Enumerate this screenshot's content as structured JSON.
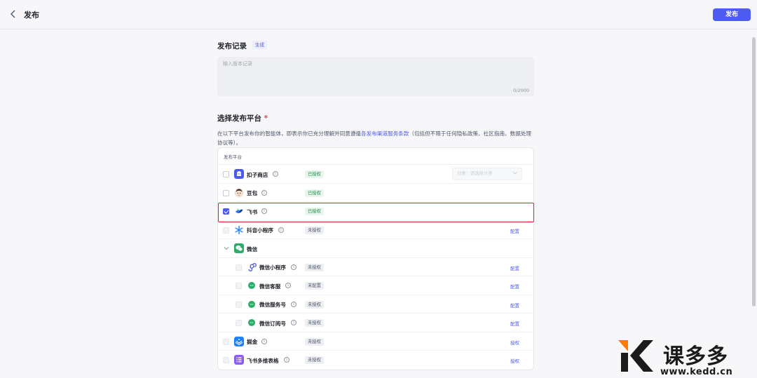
{
  "header": {
    "title": "发布",
    "publish_label": "发布"
  },
  "record": {
    "title": "发布记录",
    "generate_label": "生成",
    "placeholder": "输入版本记录",
    "counter": "0/2000"
  },
  "platforms": {
    "title": "选择发布平台",
    "required_mark": "*",
    "desc_before": "在以下平台发布你的智能体，即表示你已充分理解并同意遵循",
    "desc_link": "各发布渠道服务条款",
    "desc_after": "（包括但不限于任何隐私政策、社区指南、数据处理协议等）。",
    "column_header": "发布平台",
    "rows": [
      {
        "name": "扣子商店",
        "status": "已授权",
        "status_type": "ok",
        "checked": false,
        "icon": "coze-store-icon",
        "select_placeholder": "分类：请选择分类"
      },
      {
        "name": "豆包",
        "status": "已授权",
        "status_type": "ok",
        "checked": false,
        "icon": "doubao-icon"
      },
      {
        "name": "飞书",
        "status": "已授权",
        "status_type": "ok",
        "checked": true,
        "icon": "feishu-icon"
      },
      {
        "name": "抖音小程序",
        "status": "未授权",
        "status_type": "no",
        "checked": false,
        "disabled": true,
        "icon": "douyin-miniapp-icon",
        "action": "配置"
      },
      {
        "name": "微信",
        "group": true,
        "icon": "wechat-icon"
      },
      {
        "name": "微信小程序",
        "status": "未授权",
        "status_type": "no",
        "disabled": true,
        "icon": "wechat-miniapp-icon",
        "action": "配置"
      },
      {
        "name": "微信客服",
        "status": "未配置",
        "status_type": "no",
        "disabled": true,
        "icon": "wechat-service-icon",
        "action": "配置"
      },
      {
        "name": "微信服务号",
        "status": "未授权",
        "status_type": "no",
        "disabled": true,
        "icon": "wechat-service-account-icon",
        "action": "配置"
      },
      {
        "name": "微信订阅号",
        "status": "未授权",
        "status_type": "no",
        "disabled": true,
        "icon": "wechat-subscription-icon",
        "action": "配置"
      },
      {
        "name": "掘金",
        "status": "未授权",
        "status_type": "no",
        "disabled": true,
        "icon": "juejin-icon",
        "action": "授权"
      },
      {
        "name": "飞书多维表格",
        "status": "未授权",
        "status_type": "no",
        "disabled": true,
        "icon": "feishu-bitable-icon",
        "action": "授权"
      }
    ]
  },
  "watermark": {
    "name": "课多多",
    "url": "www.kedd.cn"
  },
  "colors": {
    "accent": "#4e5bf0",
    "highlight": "#e02020",
    "authorized_bg": "#e8f6ee",
    "authorized_text": "#2d8a4e"
  }
}
